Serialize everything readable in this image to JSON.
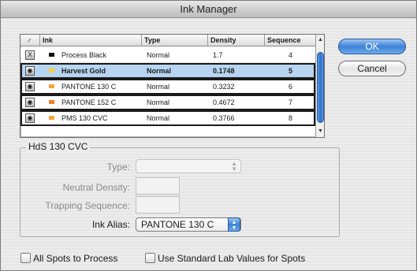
{
  "window": {
    "title": "Ink Manager"
  },
  "table": {
    "columns": {
      "icon": "♂",
      "ink": "Ink",
      "type": "Type",
      "density": "Density",
      "sequence": "Sequence"
    },
    "rows": [
      {
        "icon": "X",
        "swatch_color": "#111111",
        "ink": "Process Black",
        "type": "Normal",
        "density": "1.7",
        "sequence": "4"
      },
      {
        "icon": "◉",
        "swatch_color": "#f7d23e",
        "ink": "Harvest Gold",
        "type": "Normal",
        "density": "0.1748",
        "sequence": "5"
      },
      {
        "icon": "◉",
        "swatch_color": "#f5a33c",
        "ink": "PANTONE 130 C",
        "type": "Normal",
        "density": "0.3232",
        "sequence": "6"
      },
      {
        "icon": "◉",
        "swatch_color": "#f07f2b",
        "ink": "PANTONE 152 C",
        "type": "Normal",
        "density": "0.4672",
        "sequence": "7"
      },
      {
        "icon": "◉",
        "swatch_color": "#f5a33c",
        "ink": "PMS 130 CVC",
        "type": "Normal",
        "density": "0.3766",
        "sequence": "8"
      }
    ]
  },
  "buttons": {
    "ok": "OK",
    "cancel": "Cancel"
  },
  "group": {
    "title": "HdS 130 CVC",
    "type_label": "Type:",
    "neutral_density_label": "Neutral Density:",
    "trapping_sequence_label": "Trapping Sequence:",
    "ink_alias_label": "Ink Alias:",
    "ink_alias_value": "PANTONE 130 C"
  },
  "checkboxes": {
    "all_spots": "All Spots to Process",
    "standard_lab": "Use Standard Lab Values for Spots"
  }
}
